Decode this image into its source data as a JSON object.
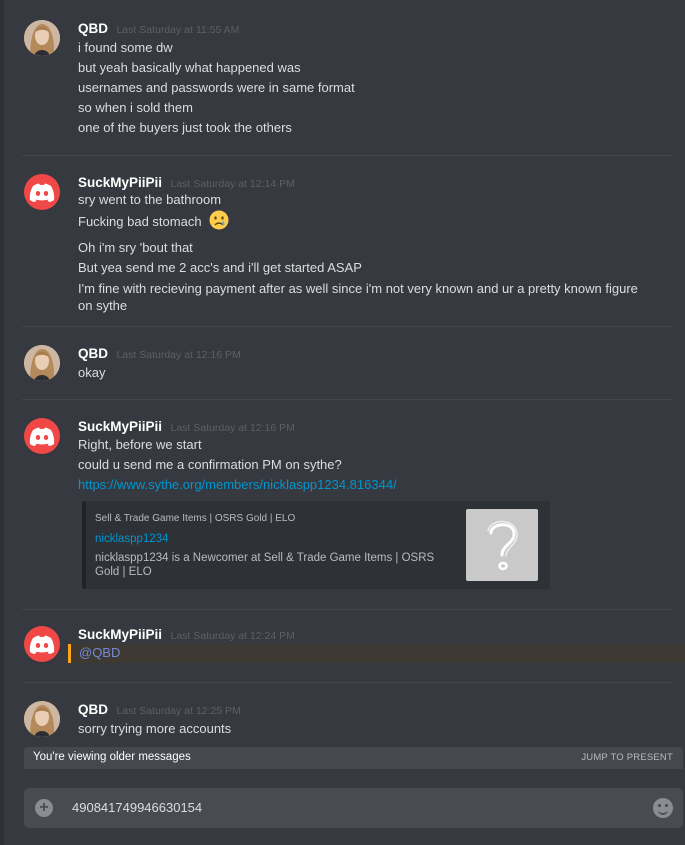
{
  "messages": [
    {
      "user": "QBD",
      "timestamp": "Last Saturday at 11:55 AM",
      "avatar_icon": "user-photo-avatar",
      "lines": [
        "i found some dw",
        "but yeah basically what happened was",
        "usernames and passwords were in same format",
        "so when i sold them",
        "one of the buyers just took the others"
      ]
    },
    {
      "user": "SuckMyPiiPii",
      "timestamp": "Last Saturday at 12:14 PM",
      "avatar_icon": "discord-default-avatar",
      "lines": [
        "sry went to the bathroom",
        "Fucking bad stomach",
        "Oh i'm sry 'bout that",
        "But yea send me 2 acc's and i'll get started ASAP",
        "I'm fine with recieving payment after as well since i'm not very known and ur a pretty known figure on sythe"
      ]
    },
    {
      "user": "QBD",
      "timestamp": "Last Saturday at 12:16 PM",
      "avatar_icon": "user-photo-avatar",
      "lines": [
        "okay"
      ]
    },
    {
      "user": "SuckMyPiiPii",
      "timestamp": "Last Saturday at 12:16 PM",
      "avatar_icon": "discord-default-avatar",
      "lines": [
        "Right, before we start",
        "could u send me a confirmation PM on sythe?"
      ],
      "link": "https://www.sythe.org/members/nicklaspp1234.816344/",
      "embed": {
        "provider": "Sell & Trade Game Items | OSRS Gold | ELO",
        "title": "nicklaspp1234",
        "description": "nicklaspp1234 is a Newcomer at Sell & Trade Game Items | OSRS Gold | ELO",
        "thumbnail_icon": "question-mark-icon"
      }
    },
    {
      "user": "SuckMyPiiPii",
      "timestamp": "Last Saturday at 12:24 PM",
      "avatar_icon": "discord-default-avatar",
      "mention": "@QBD"
    },
    {
      "user": "QBD",
      "timestamp": "Last Saturday at 12:25 PM",
      "avatar_icon": "user-photo-avatar",
      "lines": [
        "sorry trying more accounts"
      ]
    }
  ],
  "older_bar": {
    "text": "You're viewing older messages",
    "jump_label": "JUMP TO PRESENT"
  },
  "composer": {
    "value": "490841749946630154",
    "attach_icon": "plus-circle-icon",
    "emoji_icon": "smiley-icon"
  },
  "colors": {
    "background": "#36393f",
    "link": "#0096cf",
    "mention": "#7289da",
    "mention_highlight": "#faa61a",
    "discord_red": "#f04747"
  }
}
